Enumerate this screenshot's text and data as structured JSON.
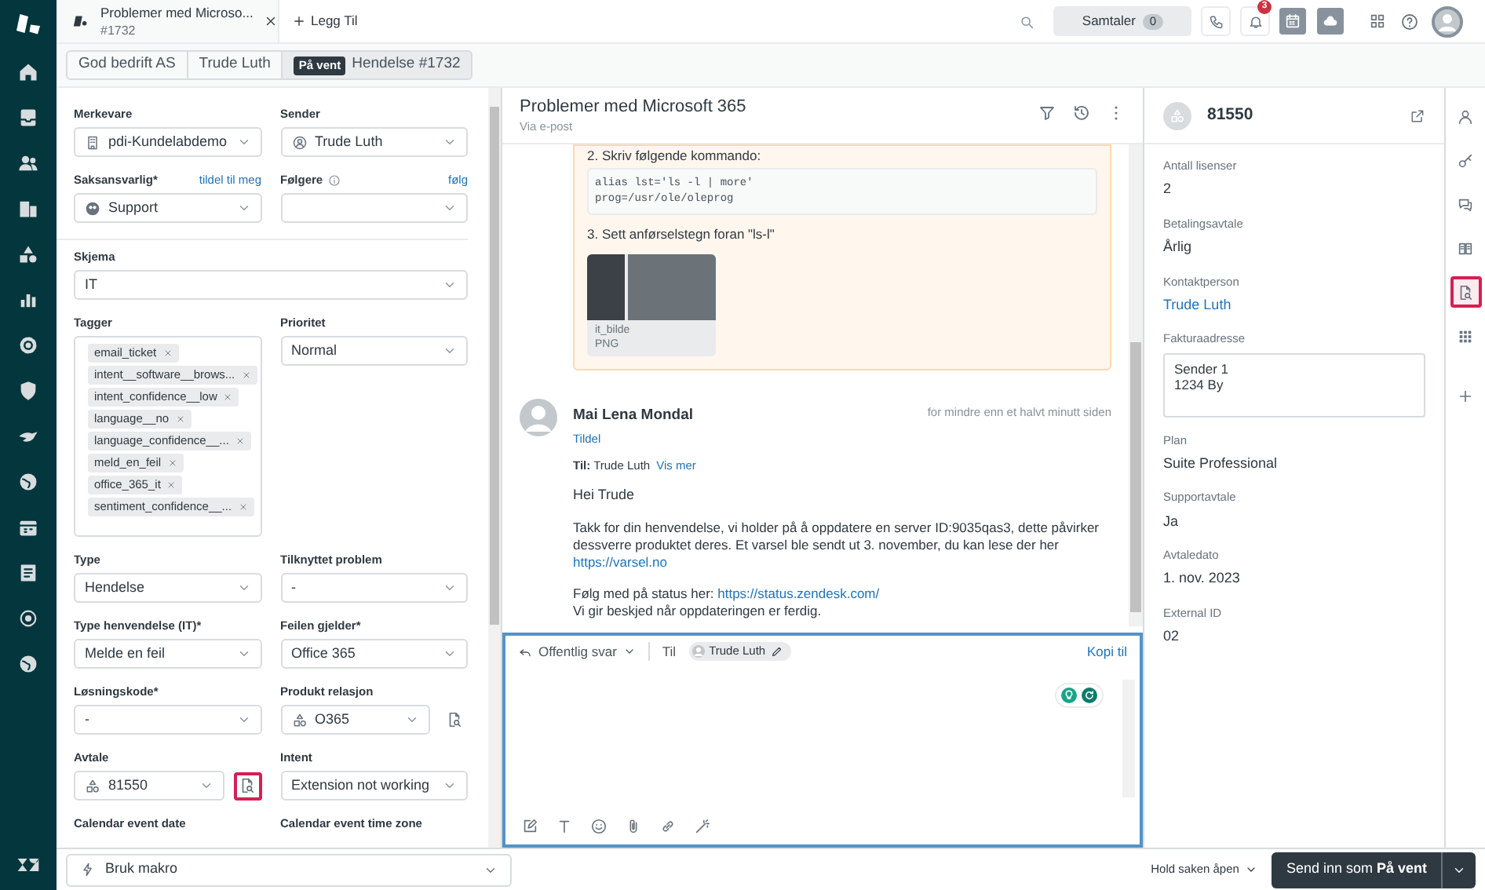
{
  "tab": {
    "title": "Problemer med Microso...",
    "subtitle": "#1732"
  },
  "add_tab": "Legg Til",
  "toolbar": {
    "conversations": "Samtaler",
    "conversations_count": "0",
    "notifications_count": "3"
  },
  "breadcrumbs": [
    {
      "kind": "link",
      "label": "God bedrift AS"
    },
    {
      "kind": "link",
      "label": "Trude Luth"
    },
    {
      "kind": "ticket",
      "badge": "På vent",
      "label": "Hendelse #1732"
    }
  ],
  "form": {
    "sections": [
      [
        [
          {
            "kind": "brand_select",
            "label": "Merkevare",
            "value": "pdi-Kundelabdemo"
          },
          {
            "kind": "user_select",
            "label": "Sender",
            "value": "Trude Luth"
          }
        ],
        [
          {
            "kind": "group_select",
            "label": "Saksansvarlig*",
            "action": "tildel til meg",
            "value": "Support"
          },
          {
            "kind": "select",
            "label": "Følgere",
            "info": true,
            "action": "følg"
          }
        ]
      ],
      [
        [
          {
            "kind": "select",
            "label": "Skjema",
            "value": "IT"
          }
        ],
        [
          {
            "kind": "tags",
            "label": "Tagger",
            "tags": [
              "email_ticket",
              "intent__software__brows...",
              "intent_confidence__low",
              "language__no",
              "language_confidence__...",
              "meld_en_feil",
              "office_365_it",
              "sentiment_confidence__..."
            ]
          },
          {
            "kind": "select",
            "label": "Prioritet",
            "value": "Normal"
          }
        ],
        [
          {
            "kind": "select",
            "label": "Type",
            "value": "Hendelse"
          },
          {
            "kind": "select",
            "label": "Tilknyttet problem",
            "value": "-"
          }
        ],
        [
          {
            "kind": "select",
            "label": "Type henvendelse (IT)*",
            "value": "Melde en feil"
          },
          {
            "kind": "select",
            "label": "Feilen gjelder*",
            "value": "Office 365"
          }
        ],
        [
          {
            "kind": "select",
            "label": "Løsningskode*",
            "value": "-"
          },
          {
            "kind": "lookup_select",
            "label": "Produkt relasjon",
            "value": "O365",
            "highlighted": false
          }
        ],
        [
          {
            "kind": "lookup_select",
            "label": "Avtale",
            "value": "81550",
            "highlighted": true
          },
          {
            "kind": "select",
            "label": "Intent",
            "value": "Extension not working"
          }
        ],
        [
          {
            "kind": "label_only",
            "label": "Calendar event date"
          },
          {
            "kind": "label_only",
            "label": "Calendar event time zone"
          }
        ]
      ]
    ]
  },
  "macro": "Bruk makro",
  "conversation": {
    "title": "Problemer med Microsoft 365",
    "via": "Via e-post",
    "step2": "2. Skriv følgende kommando:",
    "code": [
      "alias lst='ls -l | more'",
      "prog=/usr/ole/oleprog"
    ],
    "step3": "3. Sett anførselstegn foran \"ls-l\"",
    "attachment": {
      "name": "it_bilde",
      "type": "PNG"
    },
    "message": {
      "author": "Mai Lena Mondal",
      "action": "Tildel",
      "time": "for mindre enn et halvt minutt siden",
      "to": "**Til:** Trude Luth",
      "more": "Vis mer",
      "greeting": "Hei Trude",
      "paragraphs": [
        {
          "text": "Takk for din henvendelse, vi holder på å oppdatere en server ID:9035qas3, dette påvirker dessverre produktet deres. Et varsel ble sendt ut 3. november, du kan lese der her",
          "link": "https://varsel.no"
        },
        {
          "text": "Følg med på status her:",
          "link": "https://status.zendesk.com/",
          "after": "Vi gir beskjed når oppdateringen er ferdig."
        }
      ]
    }
  },
  "composer": {
    "reply_type": "Offentlig svar",
    "to_label": "Til",
    "recipient": "Trude Luth",
    "cc": "Kopi til"
  },
  "footer": {
    "status_option": "Hold saken åpen",
    "submit": "Send inn som **På vent**"
  },
  "customer": {
    "id": "81550",
    "fields": [
      {
        "kind": "text",
        "label": "Antall lisenser",
        "value": "2"
      },
      {
        "kind": "text",
        "label": "Betalingsavtale",
        "value": "Årlig"
      },
      {
        "kind": "link",
        "label": "Kontaktperson",
        "value": "Trude Luth"
      },
      {
        "kind": "textarea",
        "label": "Fakturaadresse",
        "lines": [
          "Sender 1",
          "1234 By"
        ]
      },
      {
        "kind": "text",
        "label": "Plan",
        "value": "Suite Professional"
      },
      {
        "kind": "text",
        "label": "Supportavtale",
        "value": "Ja"
      },
      {
        "kind": "text",
        "label": "Avtaledato",
        "value": "1. nov. 2023"
      },
      {
        "kind": "text",
        "label": "External ID",
        "value": "02"
      }
    ]
  },
  "rail": [
    {
      "selected": false
    },
    {
      "selected": false
    },
    {
      "selected": false
    },
    {
      "selected": false
    },
    {
      "selected": true
    },
    {
      "selected": false
    },
    {
      "selected": false
    }
  ]
}
